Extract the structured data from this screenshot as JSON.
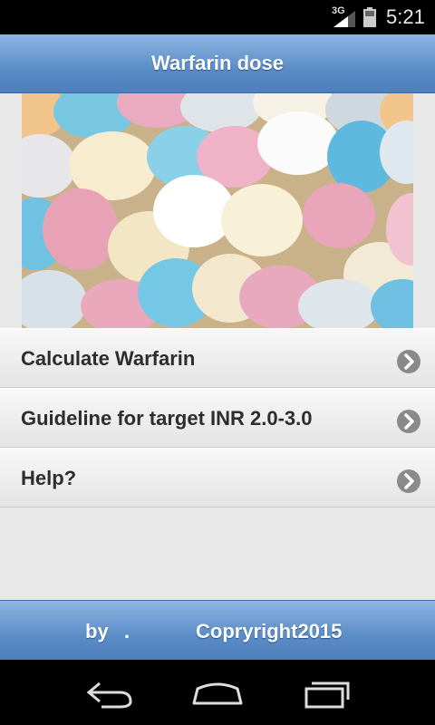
{
  "status_bar": {
    "network": "3G",
    "time": "5:21",
    "icons": [
      "signal-icon",
      "battery-icon"
    ]
  },
  "header": {
    "title": "Warfarin dose"
  },
  "banner": {
    "image": "pills-photo"
  },
  "menu": {
    "items": [
      {
        "label": "Calculate Warfarin",
        "icon": "chevron-right-icon"
      },
      {
        "label": "Guideline for target INR 2.0-3.0",
        "icon": "chevron-right-icon"
      },
      {
        "label": "Help?",
        "icon": "chevron-right-icon"
      }
    ]
  },
  "footer": {
    "by": "by",
    "dot": ".",
    "copyright": "Copryright2015"
  },
  "nav_bar": {
    "icons": [
      "back-icon",
      "home-icon",
      "recent-apps-icon"
    ]
  },
  "colors": {
    "header_blue": "#5a8cc6",
    "background": "#e8e8e8",
    "menu_text": "#2d2d2d",
    "chevron": "#8a8a8a"
  }
}
